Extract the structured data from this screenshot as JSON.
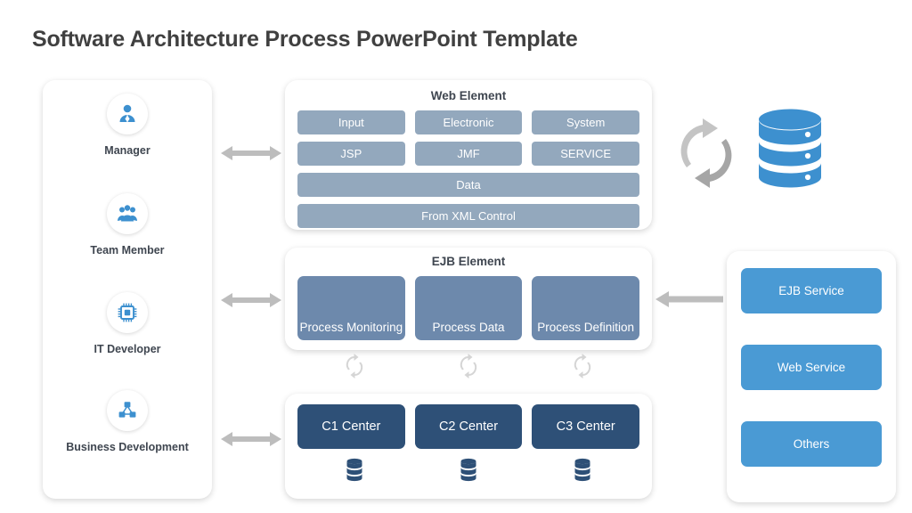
{
  "slide": {
    "title": "Software Architecture Process PowerPoint Template"
  },
  "colors": {
    "title_text": "#404040",
    "web_chip": "#93a8bd",
    "ejb_box": "#6d89ac",
    "center_box": "#2e5077",
    "service_btn": "#4a9ad4",
    "arrow_gray": "#bdbdbd",
    "icon_blue": "#3d90cf",
    "card_bg": "#ffffff",
    "page_bg": "#ffffff"
  },
  "roles": {
    "items": [
      {
        "label": "Manager",
        "icon": "manager-person-icon"
      },
      {
        "label": "Team Member",
        "icon": "team-group-icon"
      },
      {
        "label": "IT Developer",
        "icon": "cpu-chip-icon"
      },
      {
        "label": "Business Development",
        "icon": "network-nodes-icon"
      }
    ]
  },
  "web_element": {
    "heading": "Web Element",
    "row1": [
      "Input",
      "Electronic",
      "System"
    ],
    "row2": [
      "JSP",
      "JMF",
      "SERVICE"
    ],
    "row3": "Data",
    "row4": "From XML Control"
  },
  "ejb_element": {
    "heading": "EJB Element",
    "boxes": [
      "Process Monitoring",
      "Process Data",
      "Process Definition"
    ],
    "refresh_icons": [
      "refresh-circle-icon",
      "refresh-circle-icon",
      "refresh-circle-icon"
    ]
  },
  "centers": {
    "boxes": [
      "C1 Center",
      "C2 Center",
      "C3 Center"
    ],
    "db_icons": [
      "database-stack-icon",
      "database-stack-icon",
      "database-stack-icon"
    ]
  },
  "services": {
    "items": [
      "EJB Service",
      "Web Service",
      "Others"
    ]
  },
  "connectors": {
    "web_arrow": "double-arrow-icon",
    "ejb_arrow": "double-arrow-icon",
    "centers_arrow": "double-arrow-icon",
    "service_arrow": "left-arrow-icon"
  },
  "decor": {
    "sync_icon": "sync-circular-arrows-icon",
    "database_icon": "database-cylinder-icon"
  }
}
